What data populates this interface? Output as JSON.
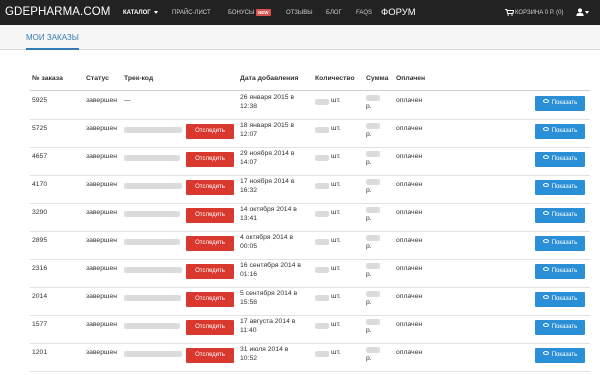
{
  "navbar": {
    "brand": "GDEPHARMA.COM",
    "items": [
      "КАТАЛОГ",
      "ПРАЙС-ЛИСТ",
      "БОНУСЫ",
      "ОТЗЫВЫ",
      "БЛОГ",
      "FAQS",
      "ФОРУМ"
    ],
    "new_badge": "NEW",
    "cart": "КОРЗИНА 0 Р. (0)",
    "cart_icon": "cart-icon",
    "user_icon": "user-icon"
  },
  "subnav": {
    "tab": "МОИ ЗАКАЗЫ"
  },
  "table": {
    "headers": [
      "№ заказа",
      "Статус",
      "Трек-код",
      "Дата добавления",
      "Количество",
      "Сумма",
      "Оплачен"
    ],
    "track_label": "Отследить",
    "show_label": "Показать",
    "qty_suffix": "шт.",
    "sum_suffix": "р.",
    "colors": {
      "track_button": "#d9382e",
      "show_button": "#2a8fd6"
    },
    "rows": [
      {
        "id": "5925",
        "status": "завершен",
        "track": "—",
        "date1": "26 января 2015 в",
        "date2": "12:38",
        "paid": "оплачен"
      },
      {
        "id": "5725",
        "status": "завершен",
        "track": "",
        "date1": "18 января 2015 в",
        "date2": "12:07",
        "paid": "оплачен"
      },
      {
        "id": "4657",
        "status": "завершен",
        "track": "",
        "date1": "29 ноября 2014 в",
        "date2": "14:07",
        "paid": "оплачен"
      },
      {
        "id": "4170",
        "status": "завершен",
        "track": "",
        "date1": "17 ноября 2014 в",
        "date2": "16:32",
        "paid": "оплачен"
      },
      {
        "id": "3290",
        "status": "завершен",
        "track": "",
        "date1": "14 октября 2014 в",
        "date2": "13:41",
        "paid": "оплачен"
      },
      {
        "id": "2895",
        "status": "завершен",
        "track": "",
        "date1": "4 октября 2014 в",
        "date2": "00:05",
        "paid": "оплачен"
      },
      {
        "id": "2316",
        "status": "завершен",
        "track": "",
        "date1": "16 сентября 2014 в",
        "date2": "01:16",
        "paid": "оплачен"
      },
      {
        "id": "2014",
        "status": "завершен",
        "track": "",
        "date1": "5 сентября 2014 в",
        "date2": "15:58",
        "paid": "оплачен"
      },
      {
        "id": "1577",
        "status": "завершен",
        "track": "",
        "date1": "17 августа 2014 в",
        "date2": "11:40",
        "paid": "оплачен"
      },
      {
        "id": "1201",
        "status": "завершен",
        "track": "",
        "date1": "31 июля 2014 в",
        "date2": "10:52",
        "paid": "оплачен"
      }
    ]
  }
}
